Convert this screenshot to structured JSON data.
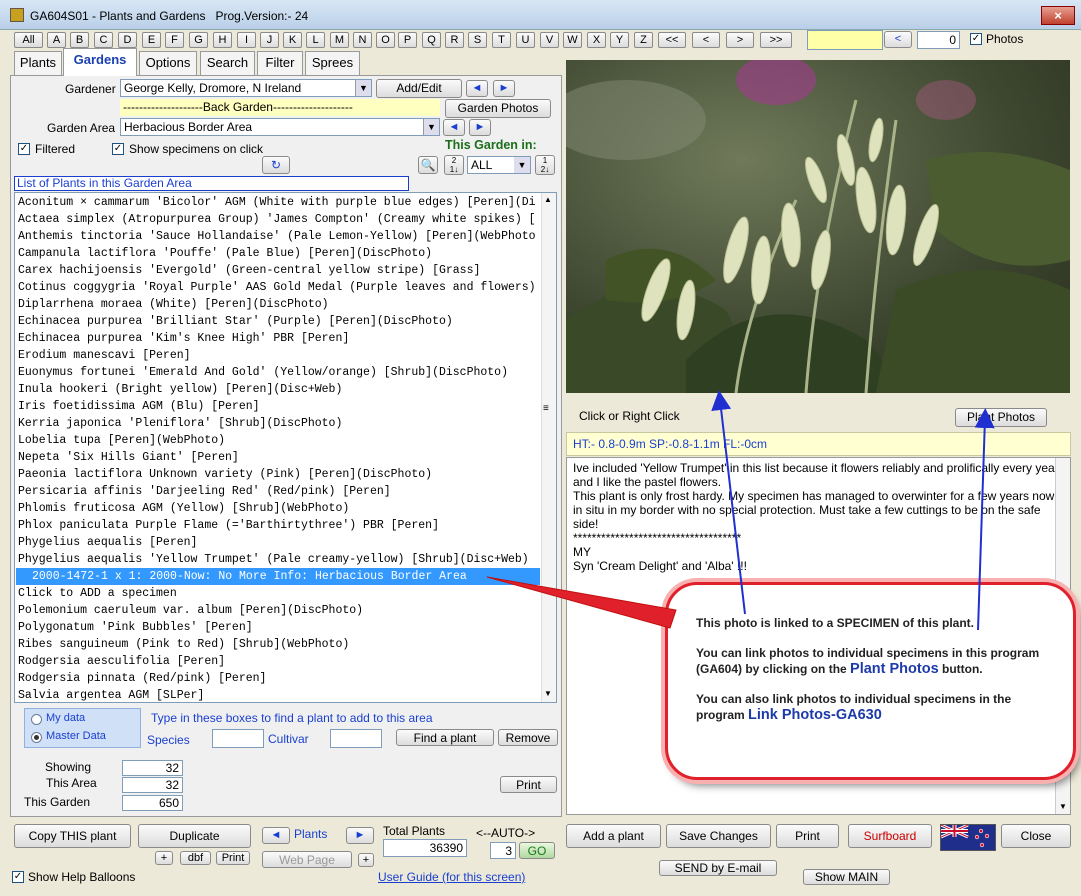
{
  "window": {
    "title": "GA604S01 - Plants and Gardens",
    "prog_version": "Prog.Version:-  24",
    "close": "×"
  },
  "alphabet": [
    "All",
    "A",
    "B",
    "C",
    "D",
    "E",
    "F",
    "G",
    "H",
    "I",
    "J",
    "K",
    "L",
    "M",
    "N",
    "O",
    "P",
    "Q",
    "R",
    "S",
    "T",
    "U",
    "V",
    "W",
    "X",
    "Y",
    "Z"
  ],
  "nav_buttons": {
    "first": "<<",
    "prev": "<",
    "next": ">",
    "last": ">>"
  },
  "top_search": {
    "value": "",
    "back_arrow": "<",
    "count": "0",
    "photos_label": "Photos",
    "photos_checked": "✓"
  },
  "tabs": [
    "Plants",
    "Gardens",
    "Options",
    "Search",
    "Filter",
    "Sprees"
  ],
  "active_tab": "Gardens",
  "gardener": {
    "label": "Gardener",
    "value": "George Kelly, Dromore, N Ireland",
    "add_edit": "Add/Edit",
    "banner": "--------------------Back Garden--------------------",
    "garden_photos": "Garden Photos"
  },
  "garden_area": {
    "label": "Garden Area",
    "value": "Herbacious Border Area"
  },
  "filtered": {
    "label": "Filtered",
    "check": "✓"
  },
  "show_specimens": {
    "label": "Show specimens on click",
    "check": "✓"
  },
  "this_garden_in": {
    "label": "This Garden in:",
    "value": "ALL"
  },
  "list_header": "List of Plants in this Garden Area",
  "plants": [
    "Aconitum × cammarum 'Bicolor' AGM (White with purple blue edges)  [Peren](Di",
    "Actaea simplex (Atropurpurea Group) 'James Compton' (Creamy white spikes)  [",
    "Anthemis tinctoria 'Sauce Hollandaise' (Pale Lemon-Yellow) [Peren](WebPhoto",
    "Campanula lactiflora 'Pouffe' (Pale Blue) [Peren](DiscPhoto)",
    "Carex hachijoensis 'Evergold' (Green-central yellow stripe) [Grass]",
    "Cotinus coggygria 'Royal Purple' AAS Gold Medal (Purple leaves and flowers)",
    "Diplarrhena moraea (White) [Peren](DiscPhoto)",
    "Echinacea purpurea 'Brilliant Star' (Purple) [Peren](DiscPhoto)",
    "Echinacea purpurea 'Kim's Knee High' PBR [Peren]",
    "Erodium manescavi [Peren]",
    "Euonymus fortunei 'Emerald And Gold' (Yellow/orange) [Shrub](DiscPhoto)",
    "Inula hookeri (Bright yellow) [Peren](Disc+Web)",
    "Iris foetidissima AGM (Blu) [Peren]",
    "Kerria japonica 'Pleniflora' [Shrub](DiscPhoto)",
    "Lobelia tupa [Peren](WebPhoto)",
    "Nepeta 'Six Hills Giant' [Peren]",
    "Paeonia lactiflora Unknown variety (Pink) [Peren](DiscPhoto)",
    "Persicaria affinis 'Darjeeling Red' (Red/pink) [Peren]",
    "Phlomis fruticosa AGM (Yellow) [Shrub](WebPhoto)",
    "Phlox paniculata Purple Flame (='Barthirtythree') PBR [Peren]",
    "Phygelius aequalis [Peren]",
    "Phygelius aequalis 'Yellow Trumpet' (Pale creamy-yellow) [Shrub](Disc+Web)",
    "2000-1472-1 x 1: 2000-Now: No More Info: Herbacious Border Area",
    "        Click to ADD a specimen",
    "Polemonium caeruleum var. album [Peren](DiscPhoto)",
    "Polygonatum 'Pink Bubbles' [Peren]",
    "Ribes sanguineum (Pink to Red) [Shrub](WebPhoto)",
    "Rodgersia aesculifolia [Peren]",
    "Rodgersia pinnata (Red/pink) [Peren]",
    "Salvia argentea AGM [SLPer]"
  ],
  "find": {
    "my_data": "My data",
    "master_data": "Master Data",
    "hint": "Type in these boxes to find a plant to add to this area",
    "species": "Species",
    "cultivar": "Cultivar",
    "find_btn": "Find a plant",
    "remove_btn": "Remove"
  },
  "counts": {
    "showing_label": "Showing",
    "showing": "32",
    "this_area_label": "This Area",
    "this_area": "32",
    "this_garden_label": "This Garden",
    "this_garden": "650",
    "print": "Print"
  },
  "photo_panel": {
    "click_hint": "Click or Right Click",
    "plant_photos": "Plant Photos",
    "info": "HT:- 0.8-0.9m     SP:-0.8-1.1m     FL:-0cm"
  },
  "notes": "Ive included 'Yellow Trumpet' in this list because it flowers reliably and prolifically every year, and I like the pastel flowers.\nThis plant is only frost hardy. My specimen has managed to overwinter for a few years now in situ in my border with no special protection. Must take a few cuttings to be on the safe side!\n************************************\nMY\nSyn 'Cream Delight' and 'Alba' !!!",
  "balloon": {
    "p1": "This photo is linked to a SPECIMEN of this plant.",
    "p2a": "You can link photos to individual specimens in this program (GA604) by clicking on the ",
    "p2b": "Plant Photos",
    "p2c": " button.",
    "p3a": "You can also link photos to individual specimens in the program ",
    "p3b": "Link Photos-GA630"
  },
  "bottom": {
    "copy": "Copy THIS plant",
    "duplicate": "Duplicate",
    "plus": "+",
    "dbf": "dbf",
    "print_small": "Print",
    "plants_nav": "Plants",
    "web_page": "Web Page",
    "total_label": "Total Plants",
    "total": "36390",
    "auto_label": "<--AUTO->",
    "auto_value": "3",
    "go": "GO",
    "add_plant": "Add a plant",
    "save": "Save Changes",
    "print": "Print",
    "surfboard": "Surfboard",
    "close": "Close",
    "send_email": "SEND by E-mail",
    "show_main": "Show MAIN",
    "help_balloons": "Show Help Balloons",
    "help_check": "✓",
    "user_guide": "User Guide (for this screen)"
  },
  "colors": {
    "accent_blue": "#1a3fd0",
    "selection": "#3399ff",
    "balloon_border": "#e0202a",
    "info_bg": "#ffffd2",
    "surfboard_red": "#cc0000"
  }
}
